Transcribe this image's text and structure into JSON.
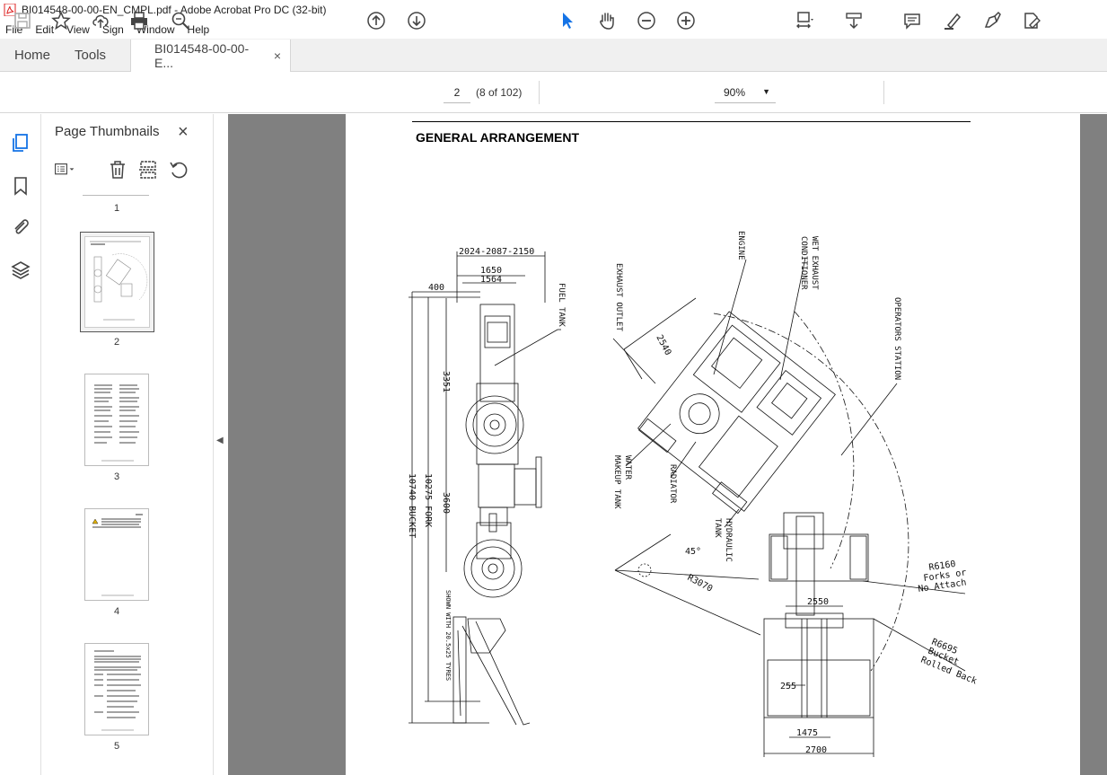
{
  "window": {
    "title": "BI014548-00-00-EN_CMPL.pdf - Adobe Acrobat Pro DC (32-bit)"
  },
  "menu": [
    "File",
    "Edit",
    "View",
    "Sign",
    "Window",
    "Help"
  ],
  "tabs": {
    "home": "Home",
    "tools": "Tools",
    "document": "BI014548-00-00-E...",
    "close": "×"
  },
  "toolbar": {
    "page_value": "2",
    "page_count": "(8 of 102)",
    "zoom": "90%"
  },
  "panel": {
    "title": "Page Thumbnails",
    "close": "×"
  },
  "thumbnails": {
    "labels": [
      "1",
      "2",
      "3",
      "4",
      "5"
    ],
    "active_page": "2"
  },
  "document": {
    "heading": "GENERAL ARRANGEMENT",
    "dimensions": {
      "overall_width": "2024-2087-2150",
      "width_1650": "1650",
      "width_1564": "1564",
      "offset_400": "400",
      "len_3351": "3351",
      "len_3600": "3600",
      "len_fork": "10275 FORK",
      "len_bucket": "10740 BUCKET",
      "track_2550": "2550",
      "dim_255": "255",
      "dim_1475": "1475",
      "dim_2700": "2700",
      "dim_2540": "2540",
      "radius_3070": "R3070",
      "angle_45": "45°",
      "radius_6160": "R6160",
      "radius_6160_note1": "Forks or",
      "radius_6160_note2": "No Attach",
      "radius_6695": "R6695",
      "radius_6695_note1": "Bucket",
      "radius_6695_note2": "Rolled Back"
    },
    "labels": {
      "fuel_tank": "FUEL TANK",
      "exhaust_outlet": "EXHAUST OUTLET",
      "engine": "ENGINE",
      "wet_exhaust_1": "WET EXHAUST",
      "wet_exhaust_2": "CONDITIONER",
      "operators_station": "OPERATORS STATION",
      "water_makeup_1": "WATER",
      "water_makeup_2": "MAKEUP TANK",
      "radiator": "RADIATOR",
      "hydraulic_1": "HYDRAULIC",
      "hydraulic_2": "TANK",
      "tyres_note": "SHOWN WITH 20.5x25 TYRES"
    }
  }
}
